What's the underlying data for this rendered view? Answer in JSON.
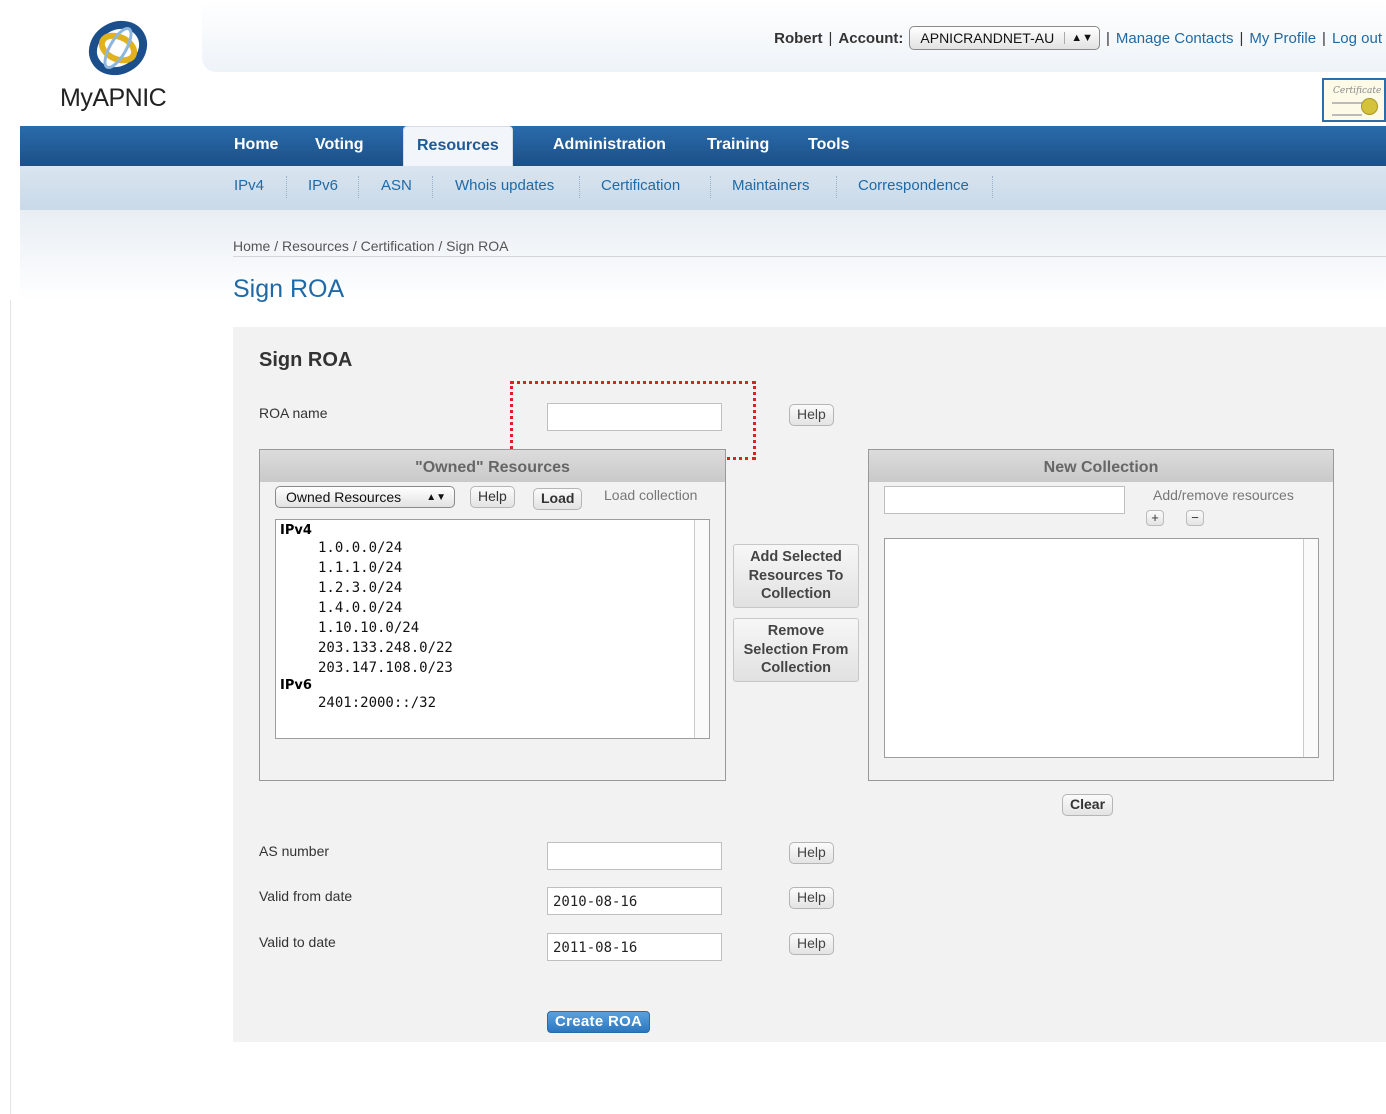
{
  "header": {
    "logo_text": "MyAPNIC",
    "user": "Robert",
    "separator": "|",
    "account_label": "Account:",
    "account_value": "APNICRANDNET-AU",
    "links": [
      "Manage Contacts",
      "My Profile",
      "Log out"
    ],
    "cert_badge_text": "Certificate"
  },
  "nav": {
    "main": [
      "Home",
      "Voting",
      "Resources",
      "Administration",
      "Training",
      "Tools"
    ],
    "active": "Resources",
    "sub": [
      "IPv4",
      "IPv6",
      "ASN",
      "Whois updates",
      "Certification",
      "Maintainers",
      "Correspondence"
    ]
  },
  "breadcrumb": "Home / Resources / Certification / Sign ROA",
  "page_title": "Sign ROA",
  "form": {
    "title": "Sign ROA",
    "roa_name_label": "ROA name",
    "roa_name_value": "",
    "help_label": "Help",
    "owned": {
      "title": "\"Owned\" Resources",
      "select_value": "Owned Resources",
      "help_label": "Help",
      "load_label": "Load",
      "load_collection_label": "Load collection",
      "ipv4_label": "IPv4",
      "ipv4": [
        "1.0.0.0/24",
        "1.1.1.0/24",
        "1.2.3.0/24",
        "1.4.0.0/24",
        "1.10.10.0/24",
        "203.133.248.0/22",
        "203.147.108.0/23"
      ],
      "ipv6_label": "IPv6",
      "ipv6": [
        "2401:2000::/32"
      ]
    },
    "add_selected_label": "Add Selected Resources To Collection",
    "remove_selection_label": "Remove Selection From Collection",
    "new_collection": {
      "title": "New Collection",
      "input_value": "",
      "add_remove_label": "Add/remove resources",
      "plus_label": "+",
      "minus_label": "−",
      "clear_label": "Clear"
    },
    "as_number_label": "AS number",
    "as_number_value": "",
    "valid_from_label": "Valid from date",
    "valid_from_value": "2010-08-16",
    "valid_to_label": "Valid to date",
    "valid_to_value": "2011-08-16",
    "create_label": "Create ROA"
  },
  "colors": {
    "nav_blue": "#1f5a94",
    "link_blue": "#1f6aa6",
    "highlight_red": "#e02020",
    "create_button": "#2b77bf"
  }
}
